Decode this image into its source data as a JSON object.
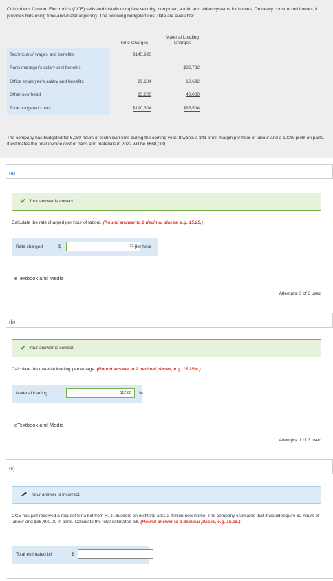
{
  "problem": {
    "intro": "Cullumber's Custom Electronics (CCE) sells and installs complete security, computer, audio, and video systems for homes. On newly constructed homes, it provides bids using time-and-material pricing. The following budgeted cost data are available:",
    "table": {
      "col_time": "Time Charges",
      "col_material": "Material Loading Charges",
      "rows": [
        {
          "label": "Technicians' wages and benefits",
          "time": "$145,920",
          "material": ""
        },
        {
          "label": "Parts manager's salary and benefits",
          "time": "",
          "material": "$32,732"
        },
        {
          "label": "Office employee's salary and benefits",
          "time": "29,184",
          "material": "12,692"
        },
        {
          "label": "Other overhead",
          "time": "15,200",
          "material": "40,080"
        },
        {
          "label": "Total budgeted costs",
          "time": "$190,304",
          "material": "$85,504"
        }
      ]
    },
    "narrative": "The company has budgeted for 6,080 hours of technician time during the coming year. It wants a $41 profit margin per hour of labour and a 100% profit on parts. It estimates the total invoice cost of parts and materials in 2022 will be $668,000."
  },
  "part_a": {
    "label": "(a)",
    "status": "Your answer is correct.",
    "question": "Calculate the rate charged per hour of labour.",
    "hint": "(Round answer to 2 decimal places, e.g. 15.25.)",
    "answer_label": "Rate charged",
    "currency": "$",
    "value": "72.3",
    "unit": "per hour",
    "etext": "eTextbook and Media",
    "attempts": "Attempts: 3 of 3 used"
  },
  "part_b": {
    "label": "(b)",
    "status": "Your answer is correct.",
    "question": "Calculate the material loading percentage.",
    "hint": "(Round answer to 2 decimal places, e.g. 15.25%.)",
    "answer_label": "Material loading",
    "value": "112.80",
    "unit": "%",
    "etext": "eTextbook and Media",
    "attempts": "Attempts: 1 of 3 used"
  },
  "part_c": {
    "label": "(c)",
    "status": "Your answer is incorrect.",
    "question": "CCE has just received a request for a bid from R. J. Builders on outfitting a $1.2-million new home. The company estimates that it would require 82 hours of labour and $36,400.00 in parts. Calculate the total estimated bill.",
    "hint": "(Round answer to 2 decimal places, e.g. 15.25.)",
    "answer_label": "Total estimated bill",
    "currency": "$",
    "value": ""
  },
  "colors": {
    "correct_bg": "#e6f2dc",
    "incorrect_bg": "#dcedf7",
    "hint": "#d9342b",
    "label_bg": "#dbe9f7"
  }
}
